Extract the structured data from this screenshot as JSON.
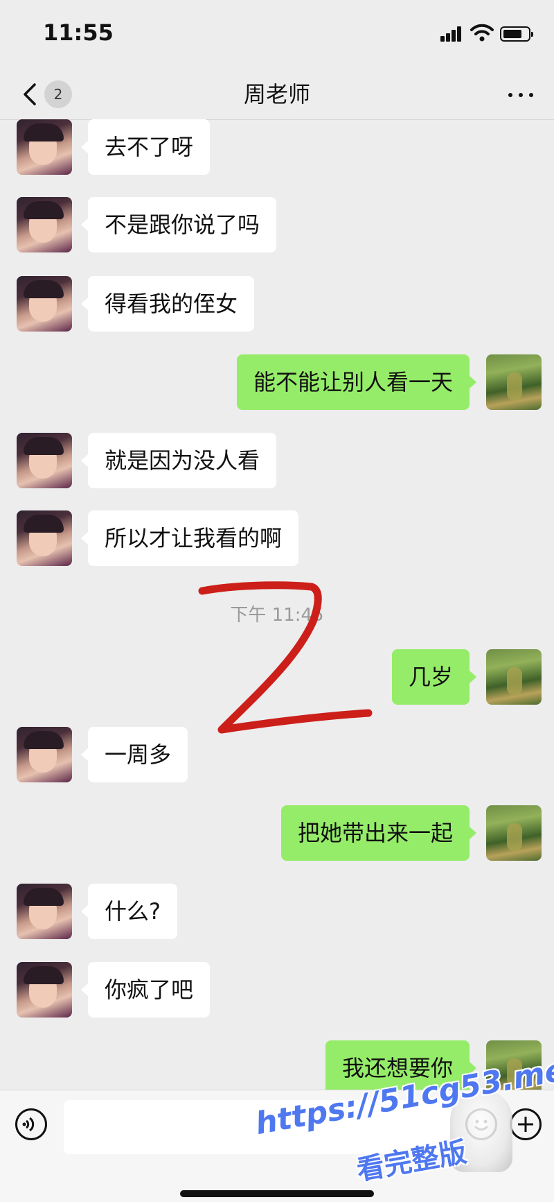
{
  "status_bar": {
    "time": "11:55"
  },
  "header": {
    "back_badge": "2",
    "title": "周老师"
  },
  "messages": [
    {
      "side": "left",
      "text": "去不了呀"
    },
    {
      "side": "left",
      "text": "不是跟你说了吗"
    },
    {
      "side": "left",
      "text": "得看我的侄女"
    },
    {
      "side": "right",
      "text": "能不能让别人看一天"
    },
    {
      "side": "left",
      "text": "就是因为没人看"
    },
    {
      "side": "left",
      "text": "所以才让我看的啊"
    },
    {
      "side": "right",
      "text": "几岁"
    },
    {
      "side": "left",
      "text": "一周多"
    },
    {
      "side": "right",
      "text": "把她带出来一起"
    },
    {
      "side": "left",
      "text": "什么?"
    },
    {
      "side": "left",
      "text": "你疯了吧"
    },
    {
      "side": "right",
      "text": "我还想要你"
    }
  ],
  "timestamp": "下午 11:45",
  "watermark": {
    "line1": "https://51cg53.me",
    "line2": "看完整版"
  },
  "colors": {
    "background": "#ededed",
    "sent_bubble": "#95ec69",
    "received_bubble": "#ffffff",
    "annotation": "#cc1f1a",
    "watermark": "#4f78f0"
  },
  "icons": [
    "chevron-left-icon",
    "more-dots-icon",
    "voice-icon",
    "emoji-icon",
    "plus-icon",
    "signal-icon",
    "wifi-icon",
    "battery-icon"
  ]
}
